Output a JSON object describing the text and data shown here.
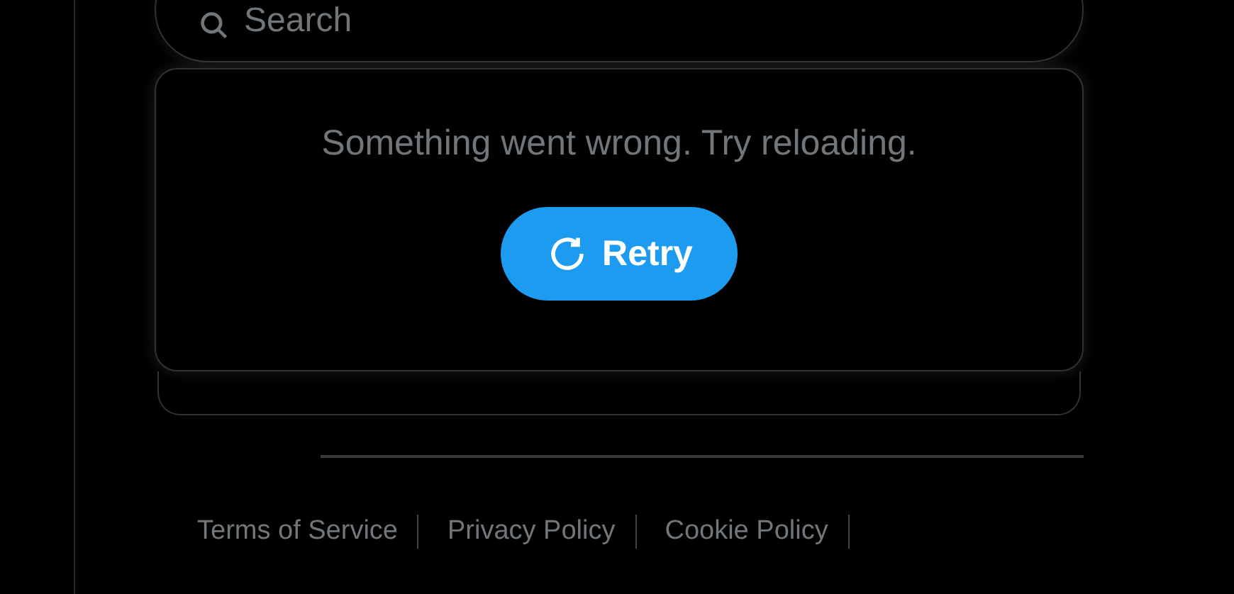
{
  "search": {
    "placeholder": "Search"
  },
  "error_card": {
    "message": "Something went wrong. Try reloading.",
    "retry_button": "Retry"
  },
  "footer": {
    "links": [
      "Terms of Service",
      "Privacy Policy",
      "Cookie Policy"
    ]
  }
}
